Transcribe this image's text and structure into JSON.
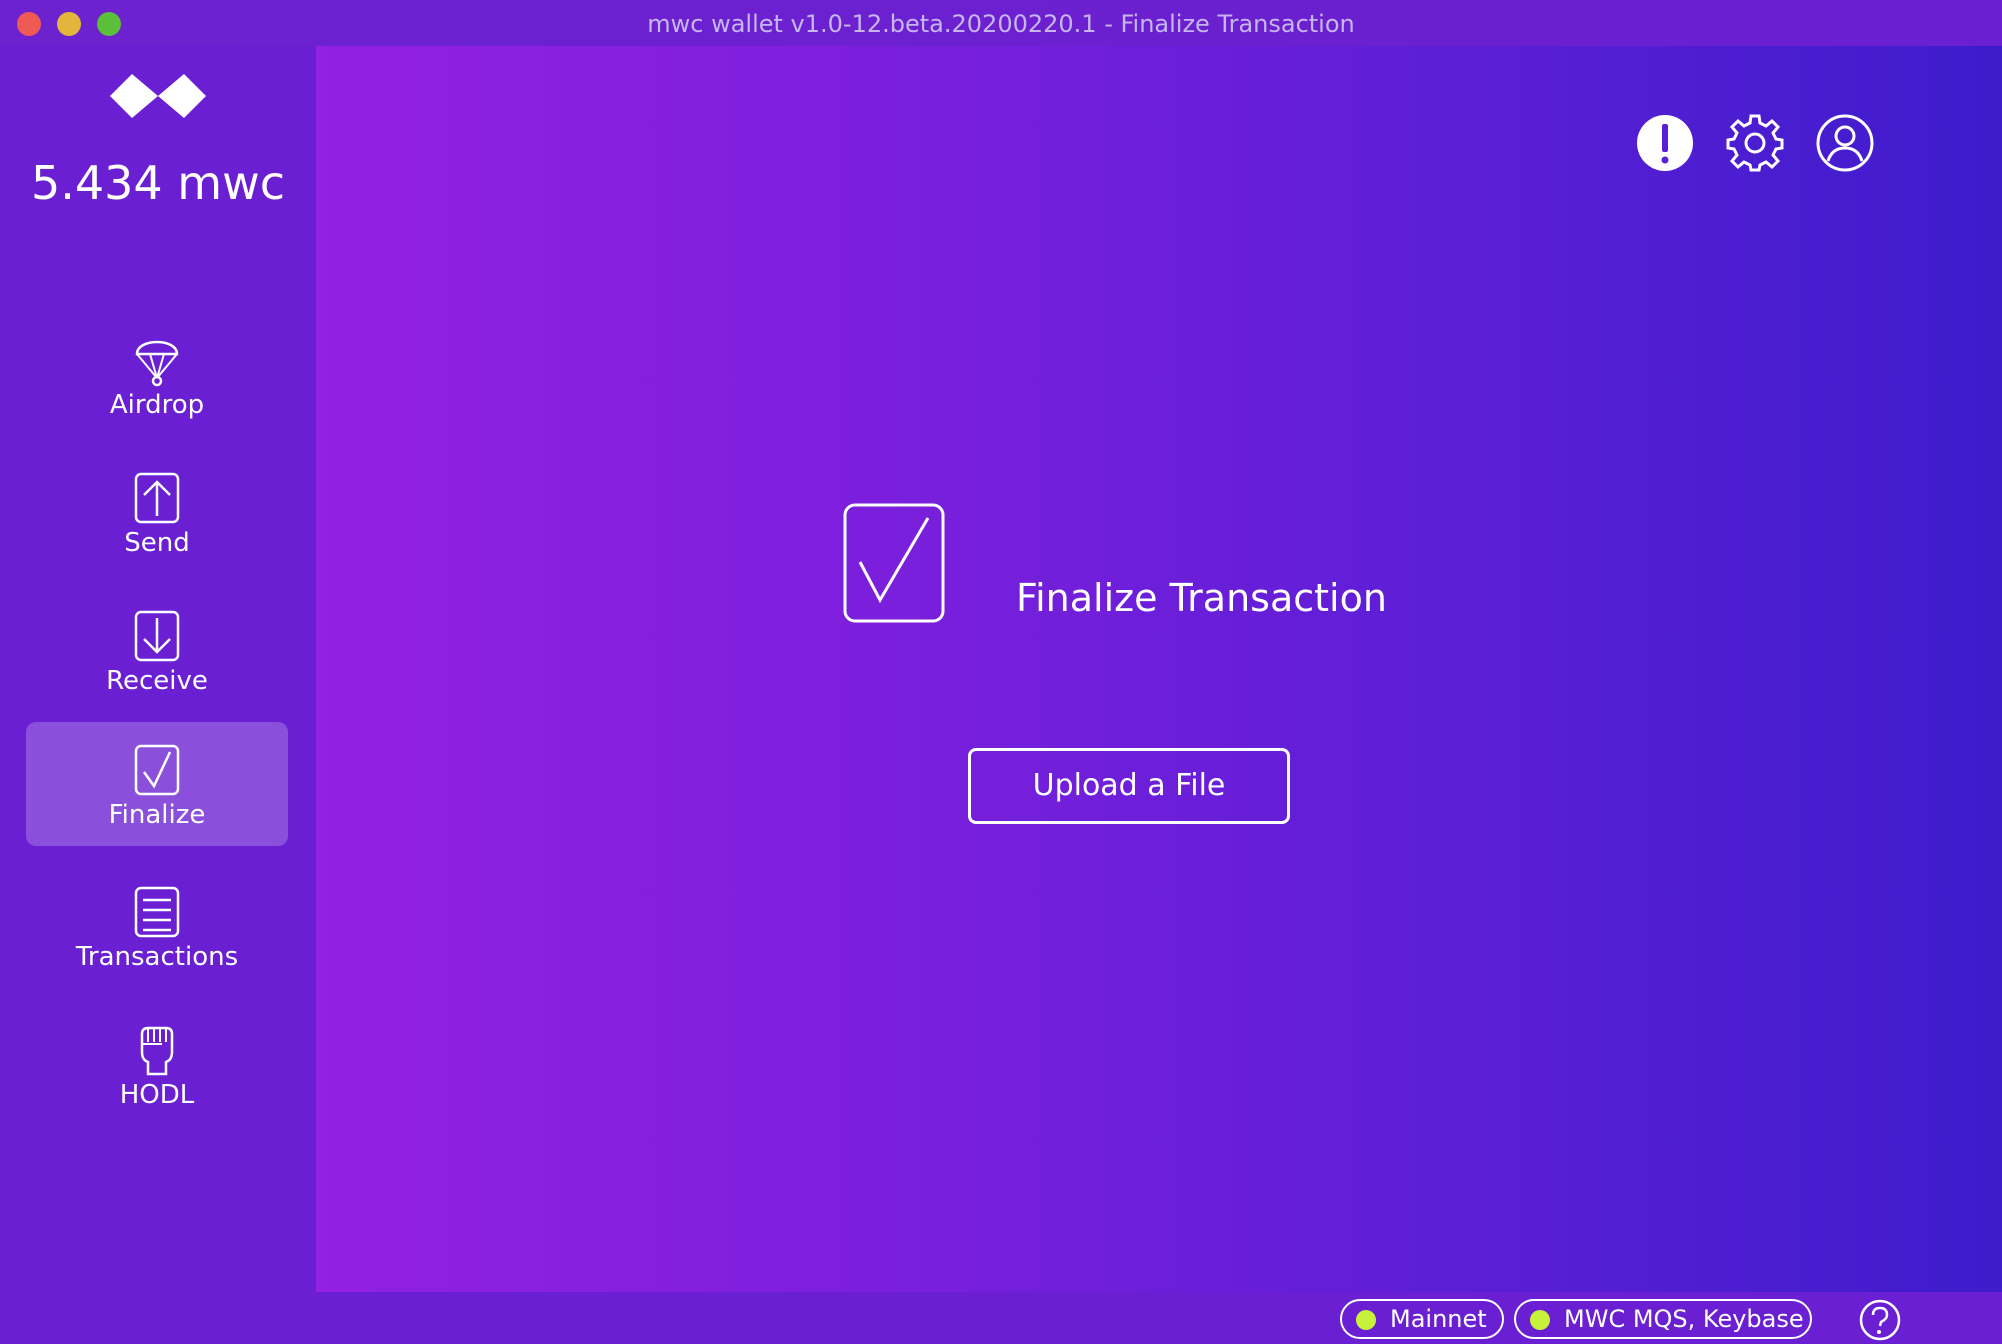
{
  "window": {
    "title": "mwc wallet v1.0-12.beta.20200220.1 - Finalize Transaction"
  },
  "sidebar": {
    "logo": "mwc-logo-icon",
    "balance": "5.434 mwc",
    "items": [
      {
        "label": "Airdrop",
        "icon": "parachute-icon",
        "active": false
      },
      {
        "label": "Send",
        "icon": "upload-arrow-icon",
        "active": false
      },
      {
        "label": "Receive",
        "icon": "download-arrow-icon",
        "active": false
      },
      {
        "label": "Finalize",
        "icon": "checkmark-icon",
        "active": true
      },
      {
        "label": "Transactions",
        "icon": "list-icon",
        "active": false
      },
      {
        "label": "HODL",
        "icon": "fist-icon",
        "active": false
      }
    ]
  },
  "header": {
    "icons": [
      "alert-icon",
      "gear-icon",
      "account-icon"
    ]
  },
  "main": {
    "icon": "checkmark-icon",
    "title": "Finalize Transaction",
    "upload_label": "Upload a File"
  },
  "statusbar": {
    "network": "Mainnet",
    "listeners": "MWC MQS, Keybase",
    "status_color": "#c8f23a",
    "help_icon": "help-icon"
  },
  "colors": {
    "sidebar_bg": "#6a1fd2",
    "gradient_start": "#9320e2",
    "gradient_end": "#3d1ccc"
  }
}
